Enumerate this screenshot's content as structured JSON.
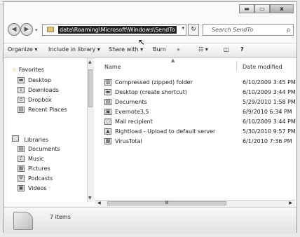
{
  "window": {
    "min_label": "▬",
    "max_label": "▭",
    "close_label": "x"
  },
  "nav": {
    "back_glyph": "◀",
    "forward_glyph": "▶",
    "dropdown_glyph": "▾",
    "address_value": "data\\Roaming\\Microsoft\\Windows\\SendTo",
    "address_dropdown_glyph": "▾",
    "refresh_glyph": "↻",
    "search_placeholder": "Search SendTo",
    "search_glyph": "ρ"
  },
  "toolbar": {
    "organize": "Organize ▾",
    "include": "Include in library ▾",
    "share": "Share with ▾",
    "burn": "Burn",
    "more": "»",
    "views": "☷ ▾",
    "preview": "◫",
    "help": "?"
  },
  "sidebar": {
    "favorites_label": "Favorites",
    "favorites": [
      {
        "label": "Desktop",
        "icon": "desktop-icon",
        "glyph": "▬"
      },
      {
        "label": "Downloads",
        "icon": "downloads-icon",
        "glyph": "↓"
      },
      {
        "label": "Dropbox",
        "icon": "dropbox-icon",
        "glyph": "▫"
      },
      {
        "label": "Recent Places",
        "icon": "recent-places-icon",
        "glyph": "▤"
      }
    ],
    "libraries_label": "Libraries",
    "libraries": [
      {
        "label": "Documents",
        "icon": "documents-icon",
        "glyph": "▤"
      },
      {
        "label": "Music",
        "icon": "music-icon",
        "glyph": "♪"
      },
      {
        "label": "Pictures",
        "icon": "pictures-icon",
        "glyph": "▦"
      },
      {
        "label": "Podcasts",
        "icon": "podcasts-icon",
        "glyph": "Ψ"
      },
      {
        "label": "Videos",
        "icon": "videos-icon",
        "glyph": "▣"
      }
    ]
  },
  "columns": {
    "name": "Name",
    "date": "Date modified",
    "sort_glyph": "▲"
  },
  "files": [
    {
      "name": "Compressed (zipped) folder",
      "date": "6/10/2009 3:45 PM",
      "icon": "zip-folder-icon",
      "glyph": "▥"
    },
    {
      "name": "Desktop (create shortcut)",
      "date": "6/10/2009 3:44 PM",
      "icon": "desktop-shortcut-icon",
      "glyph": "▬"
    },
    {
      "name": "Documents",
      "date": "5/29/2010 1:58 PM",
      "icon": "documents-icon",
      "glyph": "▤"
    },
    {
      "name": "Evernote3.5",
      "date": "6/9/2010 6:34 PM",
      "icon": "evernote-icon",
      "glyph": "▣"
    },
    {
      "name": "Mail recipient",
      "date": "6/10/2009 3:44 PM",
      "icon": "mail-icon",
      "glyph": "◌"
    },
    {
      "name": "Rightload - Upload to default server",
      "date": "5/30/2010 9:57 PM",
      "icon": "rightload-icon",
      "glyph": "▲"
    },
    {
      "name": "VirusTotal",
      "date": "6/1/2010 7:36 PM",
      "icon": "virustotal-icon",
      "glyph": "▩"
    }
  ],
  "scroll": {
    "up": "▲",
    "down": "▼",
    "left": "◀",
    "right": "▶",
    "h_grip": "III",
    "v_grip": "≡"
  },
  "status": {
    "item_count": "7 items"
  }
}
